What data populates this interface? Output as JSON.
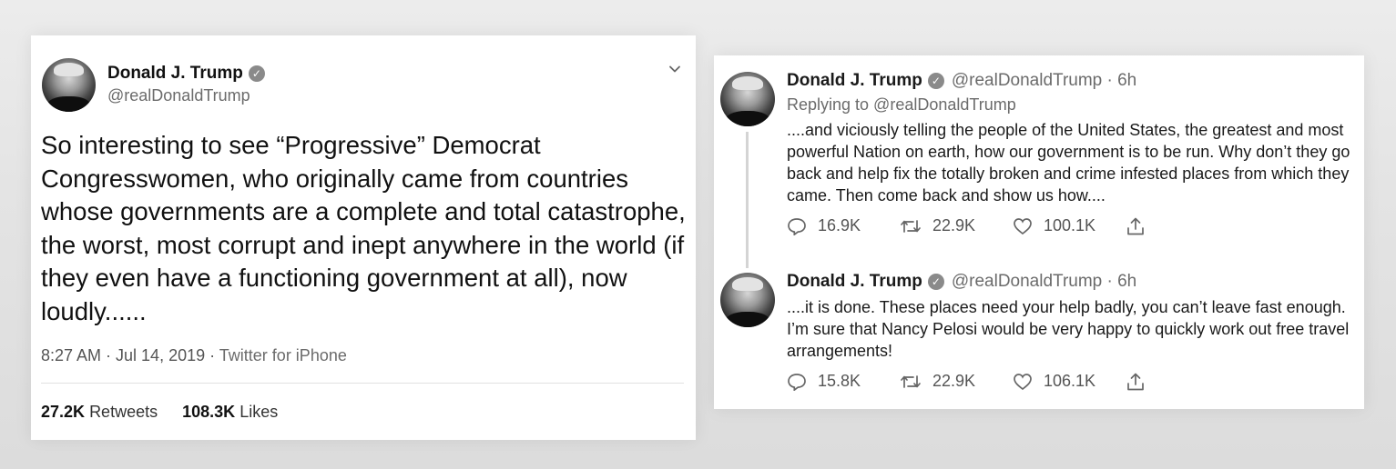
{
  "main_tweet": {
    "author_name": "Donald J. Trump",
    "verified_glyph": "✓",
    "handle": "@realDonaldTrump",
    "text": "So interesting to see “Progressive” Democrat Congresswomen, who originally came from countries whose governments are a complete and total catastrophe, the worst, most corrupt and inept anywhere in the world (if they even have a functioning government at all), now loudly......",
    "time_date": "8:27 AM · Jul 14, 2019 ·",
    "source": "Twitter for iPhone",
    "retweets_count": "27.2K",
    "retweets_label": "Retweets",
    "likes_count": "108.3K",
    "likes_label": "Likes"
  },
  "thread": [
    {
      "author_name": "Donald J. Trump",
      "verified_glyph": "✓",
      "handle_time": "@realDonaldTrump · 6h",
      "replying_to": "Replying to @realDonaldTrump",
      "text": "....and viciously telling the people of the United States, the greatest and most powerful Nation on earth, how our government is to be run. Why don’t they go back and help fix the totally broken and crime infested places from which they came. Then come back and show us how....",
      "replies": "16.9K",
      "retweets": "22.9K",
      "likes": "100.1K"
    },
    {
      "author_name": "Donald J. Trump",
      "verified_glyph": "✓",
      "handle_time": "@realDonaldTrump · 6h",
      "text": "....it is done. These places need your help badly, you can’t leave fast enough. I’m sure that Nancy Pelosi would be very happy to quickly work out free travel arrangements!",
      "replies": "15.8K",
      "retweets": "22.9K",
      "likes": "106.1K"
    }
  ],
  "icons": [
    "chevron-down-icon",
    "verified-badge-icon",
    "reply-icon",
    "retweet-icon",
    "like-icon",
    "share-icon"
  ]
}
